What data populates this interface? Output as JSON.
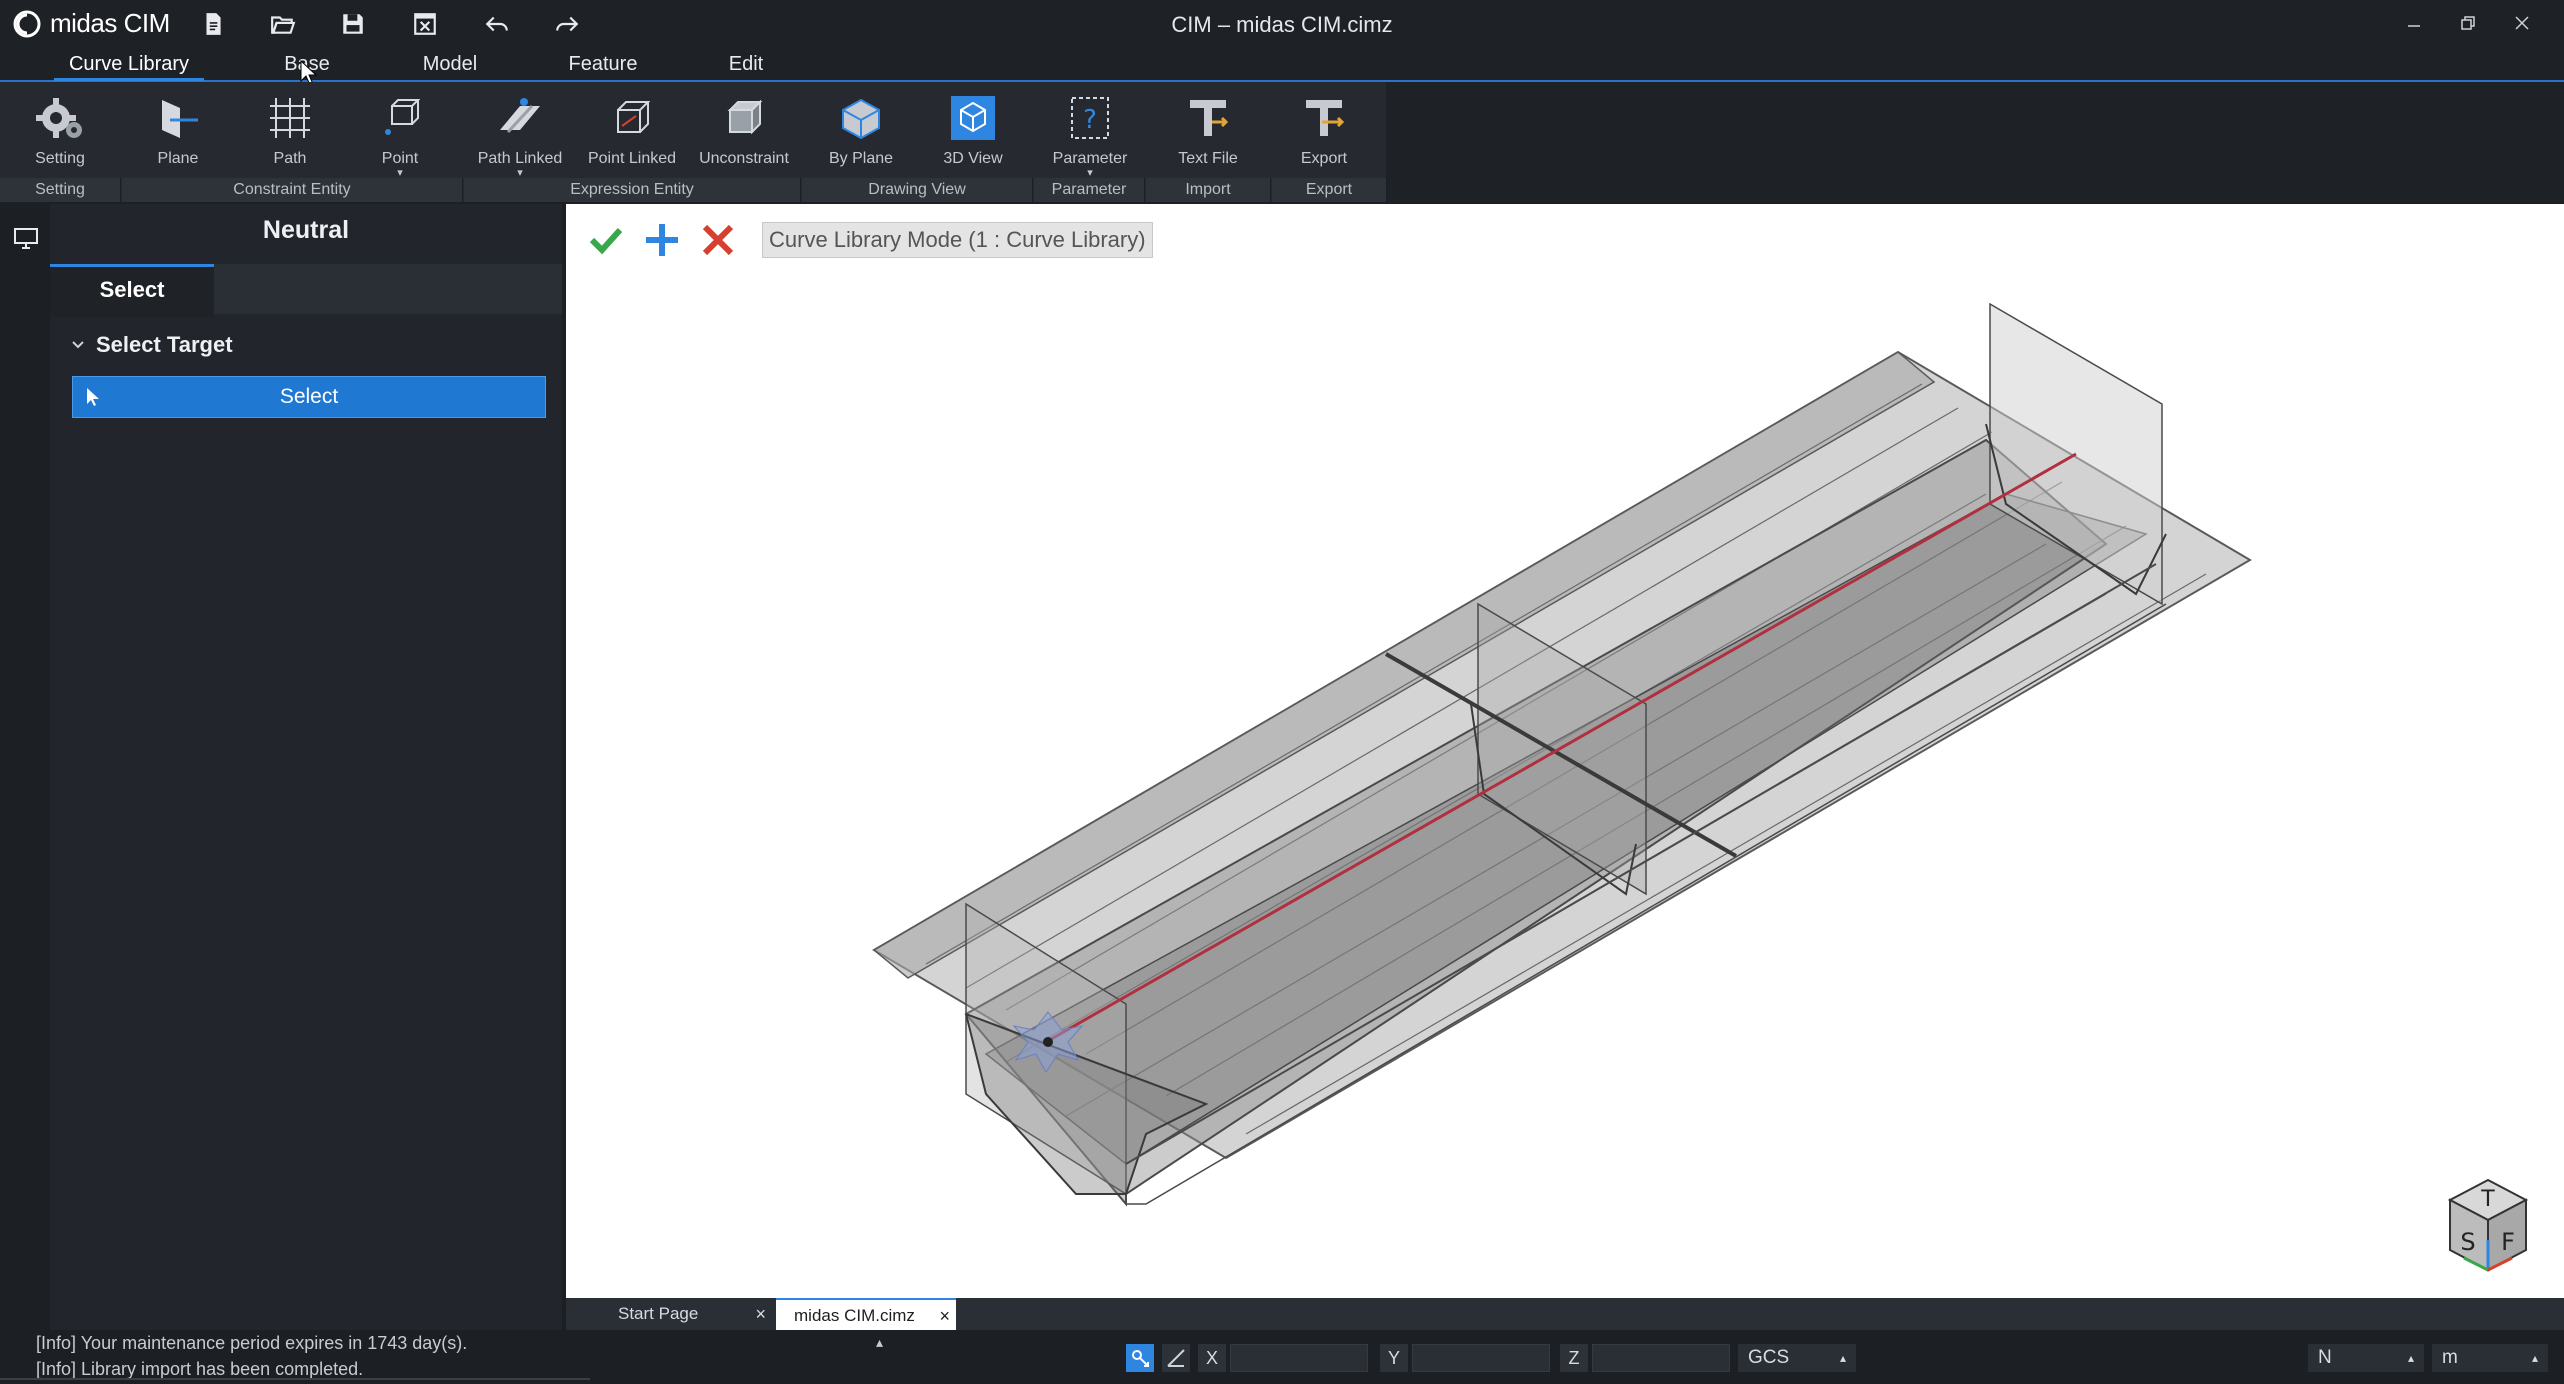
{
  "app": {
    "name": "midas CIM",
    "window_title": "CIM – midas CIM.cimz"
  },
  "menu": {
    "tabs": [
      "Curve Library",
      "Base",
      "Model",
      "Feature",
      "Edit"
    ],
    "active": "Curve Library"
  },
  "ribbon": {
    "buttons": {
      "setting": "Setting",
      "plane": "Plane",
      "path": "Path",
      "point": "Point",
      "path_linked": "Path Linked",
      "point_linked": "Point Linked",
      "unconstraint": "Unconstraint",
      "by_plane": "By Plane",
      "view_3d": "3D View",
      "parameter": "Parameter",
      "text_file": "Text File",
      "export": "Export"
    },
    "groups": {
      "setting": "Setting",
      "constraint_entity": "Constraint Entity",
      "expression_entity": "Expression Entity",
      "drawing_view": "Drawing View",
      "parameter": "Parameter",
      "import": "Import",
      "export": "Export"
    }
  },
  "panel": {
    "title": "Neutral",
    "tab": "Select",
    "section": "Select Target",
    "select_button": "Select"
  },
  "viewport": {
    "mode_label": "Curve Library Mode (1 : Curve Library)",
    "navcube": {
      "top": "T",
      "left": "S",
      "right": "F"
    }
  },
  "doc_tabs": {
    "start": "Start Page",
    "active": "midas CIM.cimz"
  },
  "status": {
    "log": [
      "[Info] Your maintenance period expires in 1743 day(s).",
      "[Info] Library import has been completed."
    ],
    "coords": {
      "x_label": "X",
      "y_label": "Y",
      "z_label": "Z",
      "x": "",
      "y": "",
      "z": ""
    },
    "coord_system": "GCS",
    "force_unit": "N",
    "length_unit": "m"
  },
  "colors": {
    "accent": "#2f86e0",
    "select_button": "#1f78d2",
    "confirm": "#3aa84a",
    "add": "#2f86e0",
    "cancel": "#d6402e",
    "path_line": "#b03040"
  }
}
